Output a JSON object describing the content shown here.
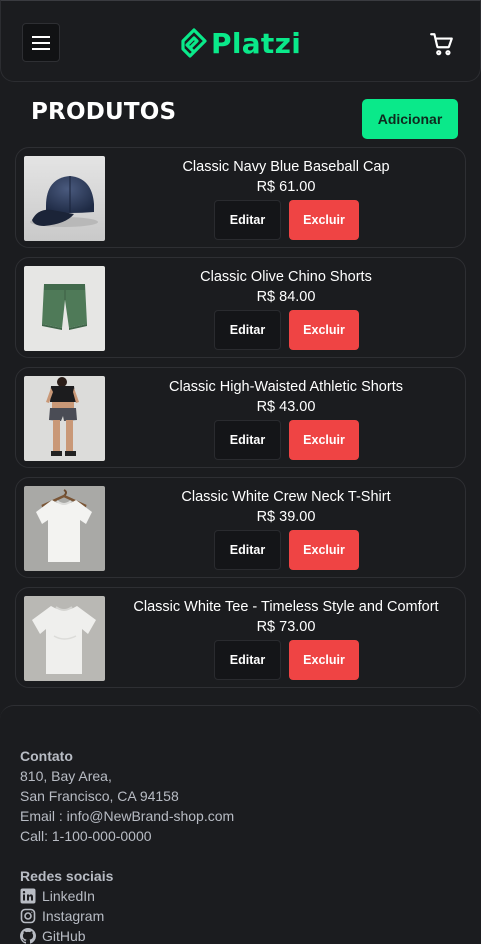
{
  "header": {
    "brand": "Platzi",
    "brand_color": "#0ae98a",
    "menu_icon": "hamburger-menu-icon",
    "cart_icon": "shopping-cart-icon"
  },
  "page": {
    "title": "PRODUTOS",
    "add_label": "Adicionar"
  },
  "products": [
    {
      "name": "Classic Navy Blue Baseball Cap",
      "price": "R$ 61.00",
      "image": "navy-cap",
      "edit_label": "Editar",
      "delete_label": "Excluir"
    },
    {
      "name": "Classic Olive Chino Shorts",
      "price": "R$ 84.00",
      "image": "olive-shorts",
      "edit_label": "Editar",
      "delete_label": "Excluir"
    },
    {
      "name": "Classic High-Waisted Athletic Shorts",
      "price": "R$ 43.00",
      "image": "athletic-shorts-model",
      "edit_label": "Editar",
      "delete_label": "Excluir"
    },
    {
      "name": "Classic White Crew Neck T-Shirt",
      "price": "R$ 39.00",
      "image": "white-tshirt-hanger",
      "edit_label": "Editar",
      "delete_label": "Excluir"
    },
    {
      "name": "Classic White Tee - Timeless Style and Comfort",
      "price": "R$ 73.00",
      "image": "white-tee",
      "edit_label": "Editar",
      "delete_label": "Excluir"
    }
  ],
  "footer": {
    "contact_title": "Contato",
    "address_line1": "810, Bay Area,",
    "address_line2": "San Francisco, CA 94158",
    "email": "Email : info@NewBrand-shop.com",
    "phone": "Call: 1-100-000-0000",
    "social_title": "Redes sociais",
    "social": [
      {
        "label": "LinkedIn",
        "icon": "linkedin-icon"
      },
      {
        "label": "Instagram",
        "icon": "instagram-icon"
      },
      {
        "label": "GitHub",
        "icon": "github-icon"
      }
    ]
  },
  "colors": {
    "background": "#1b1c1f",
    "accent": "#0ae98a",
    "danger": "#ef4444",
    "muted_text": "#b8bcc4"
  }
}
